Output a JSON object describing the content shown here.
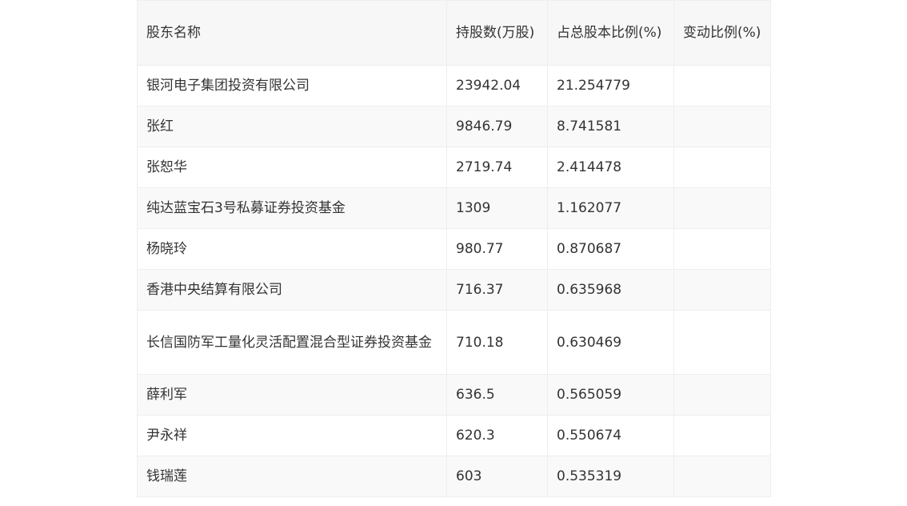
{
  "table": {
    "headers": [
      "股东名称",
      "持股数(万股)",
      "占总股本比例(%)",
      "变动比例(%)"
    ],
    "rows": [
      {
        "name": "银河电子集团投资有限公司",
        "shares": "23942.04",
        "ratio": "21.254779",
        "change": ""
      },
      {
        "name": "张红",
        "shares": "9846.79",
        "ratio": "8.741581",
        "change": ""
      },
      {
        "name": "张恕华",
        "shares": "2719.74",
        "ratio": "2.414478",
        "change": ""
      },
      {
        "name": "纯达蓝宝石3号私募证券投资基金",
        "shares": "1309",
        "ratio": "1.162077",
        "change": ""
      },
      {
        "name": "杨晓玲",
        "shares": "980.77",
        "ratio": "0.870687",
        "change": ""
      },
      {
        "name": "香港中央结算有限公司",
        "shares": "716.37",
        "ratio": "0.635968",
        "change": ""
      },
      {
        "name": "长信国防军工量化灵活配置混合型证券投资基金",
        "shares": "710.18",
        "ratio": "0.630469",
        "change": ""
      },
      {
        "name": "薛利军",
        "shares": "636.5",
        "ratio": "0.565059",
        "change": ""
      },
      {
        "name": "尹永祥",
        "shares": "620.3",
        "ratio": "0.550674",
        "change": ""
      },
      {
        "name": "钱瑞莲",
        "shares": "603",
        "ratio": "0.535319",
        "change": ""
      }
    ]
  }
}
